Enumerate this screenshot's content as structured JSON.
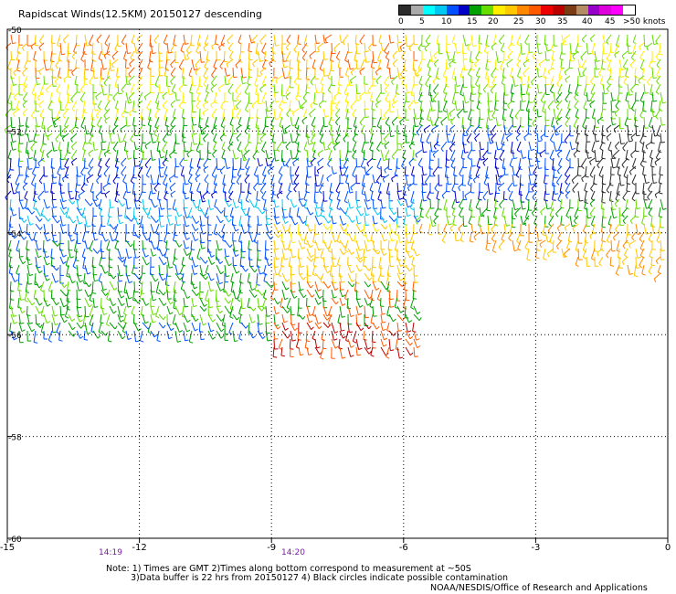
{
  "title": "Rapidscat Winds(12.5KM) 20150127 descending",
  "legend": {
    "colors": [
      "#2b2b2b",
      "#aaaaaa",
      "#00ffff",
      "#00c8f0",
      "#0050ff",
      "#0000c8",
      "#00a000",
      "#66dd00",
      "#ffee00",
      "#ffc800",
      "#ff8800",
      "#ff5a00",
      "#ee0000",
      "#bb0000",
      "#7a3c14",
      "#b48c64",
      "#9600c8",
      "#dd00dd",
      "#ff00ff",
      "#ffffff"
    ],
    "labels": [
      "0",
      "5",
      "10",
      "15",
      "20",
      "25",
      "30",
      "35",
      "40",
      "45",
      ">50 knots"
    ]
  },
  "map": {
    "lon_range": [
      -15,
      0
    ],
    "lat_range": [
      -60,
      -50
    ],
    "x_ticks": [
      "-15",
      "-12",
      "-9",
      "-6",
      "-3",
      "0"
    ],
    "y_ticks": [
      "-50",
      "-52",
      "-54",
      "-56",
      "-58",
      "-60"
    ],
    "time_labels": [
      "14:19",
      "14:20"
    ]
  },
  "notes": {
    "line1": "Note: 1) Times are GMT 2)Times along bottom correspond to measurement at ~50S",
    "line2": "3)Data buffer is 22 hrs from 20150127 4) Black circles indicate possible contamination",
    "credit": "NOAA/NESDIS/Office of Research and Applications"
  }
}
